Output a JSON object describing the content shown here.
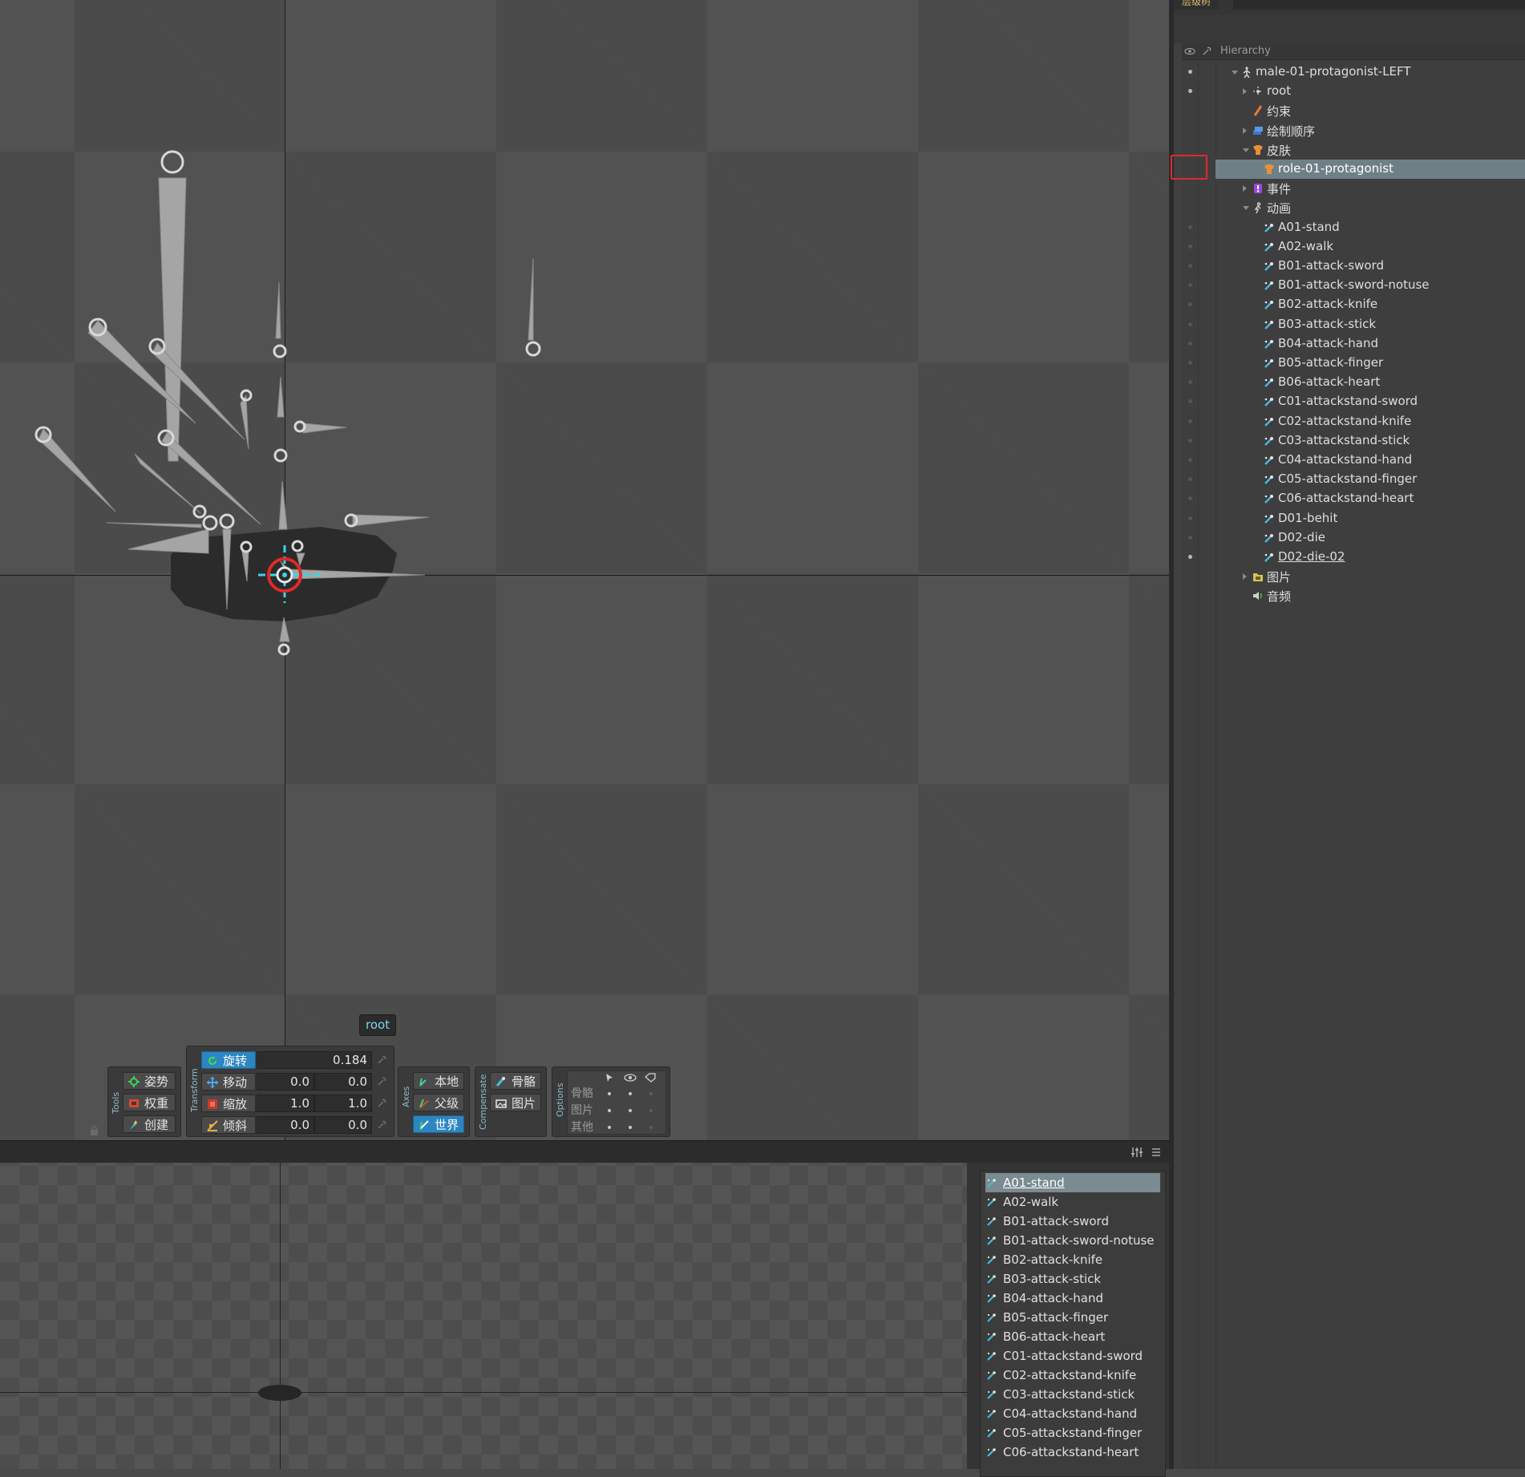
{
  "viewport": {
    "tooltip": "root"
  },
  "toolbar": {
    "tools": {
      "label": "Tools",
      "pose": "姿势",
      "weights": "权重",
      "create": "创建"
    },
    "transform": {
      "label": "Transform",
      "rotate": {
        "label": "旋转",
        "value": "0.184"
      },
      "translate": {
        "label": "移动",
        "x": "0.0",
        "y": "0.0"
      },
      "scale": {
        "label": "缩放",
        "x": "1.0",
        "y": "1.0"
      },
      "shear": {
        "label": "倾斜",
        "x": "0.0",
        "y": "0.0"
      }
    },
    "axes": {
      "label": "Axes",
      "local": "本地",
      "parent": "父级",
      "world": "世界",
      "active": "world"
    },
    "compensate": {
      "label": "Compensate",
      "bones": "骨骼",
      "images": "图片"
    },
    "options": {
      "label": "Options",
      "rows": [
        "骨骼",
        "图片",
        "其他"
      ]
    }
  },
  "hierarchy": {
    "tab": "层级树",
    "header": "Hierarchy",
    "skeleton": "male-01-protagonist-LEFT",
    "root": "root",
    "constraints": "约束",
    "draw_order": "绘制顺序",
    "skins": "皮肤",
    "skin_item": "role-01-protagonist",
    "events": "事件",
    "animations": "动画",
    "animation_items": [
      "A01-stand",
      "A02-walk",
      "B01-attack-sword",
      "B01-attack-sword-notuse",
      "B02-attack-knife",
      "B03-attack-stick",
      "B04-attack-hand",
      "B05-attack-finger",
      "B06-attack-heart",
      "C01-attackstand-sword",
      "C02-attackstand-knife",
      "C03-attackstand-stick",
      "C04-attackstand-hand",
      "C05-attackstand-finger",
      "C06-attackstand-heart",
      "D01-behit",
      "D02-die",
      "D02-die-02"
    ],
    "images": "图片",
    "audio": "音频"
  },
  "animation_list": {
    "selected": "A01-stand",
    "items": [
      "A01-stand",
      "A02-walk",
      "B01-attack-sword",
      "B01-attack-sword-notuse",
      "B02-attack-knife",
      "B03-attack-stick",
      "B04-attack-hand",
      "B05-attack-finger",
      "B06-attack-heart",
      "C01-attackstand-sword",
      "C02-attackstand-knife",
      "C03-attackstand-stick",
      "C04-attackstand-hand",
      "C05-attackstand-finger",
      "C06-attackstand-heart"
    ]
  },
  "colors": {
    "accent_blue": "#2c86c2",
    "selection": "#6e8086",
    "highlight_red": "#e02a2a",
    "root_cyan": "#39d4e8"
  }
}
